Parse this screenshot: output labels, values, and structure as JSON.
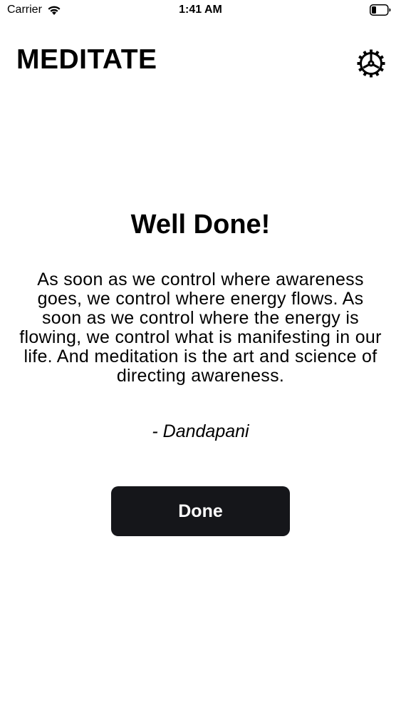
{
  "status_bar": {
    "carrier": "Carrier",
    "time": "1:41 AM",
    "wifi_icon": "wifi-icon",
    "battery_icon": "battery-icon"
  },
  "header": {
    "title": "MEDITATE",
    "settings_icon": "gear-icon"
  },
  "main": {
    "heading": "Well Done!",
    "quote": "As soon as we control where awareness goes, we control where energy flows. As soon as we control where the energy is flowing, we control what is manifesting in our life. And meditation is the art and science of directing awareness.",
    "author": "- Dandapani",
    "done_label": "Done"
  },
  "colors": {
    "background": "#ffffff",
    "text": "#000000",
    "button_background": "#15161a",
    "button_text": "#ffffff"
  }
}
